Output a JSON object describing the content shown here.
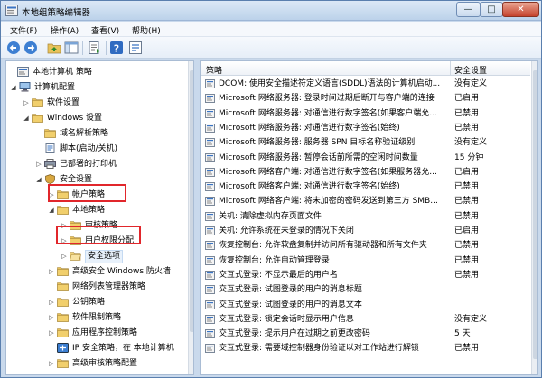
{
  "window": {
    "title": "本地组策略编辑器",
    "minimize_label": "—",
    "maximize_label": "□",
    "close_label": "✕"
  },
  "menu": {
    "items": [
      "文件(F)",
      "操作(A)",
      "查看(V)",
      "帮助(H)"
    ]
  },
  "toolbar": {
    "icons": [
      "back-arrow-icon",
      "forward-arrow-icon",
      "up-folder-icon",
      "show-hide-tree-icon",
      "export-list-icon",
      "help-icon",
      "properties-icon"
    ]
  },
  "tree": {
    "items": [
      {
        "label": "本地计算机 策略",
        "icon": "computer-policy-icon",
        "expander": ""
      },
      {
        "label": "计算机配置",
        "icon": "computer-config-icon",
        "expander": "◢"
      },
      {
        "label": "软件设置",
        "icon": "folder-icon",
        "expander": "▷"
      },
      {
        "label": "Windows 设置",
        "icon": "folder-icon",
        "expander": "◢"
      },
      {
        "label": "域名解析策略",
        "icon": "folder-icon",
        "expander": ""
      },
      {
        "label": "脚本(启动/关机)",
        "icon": "script-icon",
        "expander": ""
      },
      {
        "label": "已部署的打印机",
        "icon": "printer-icon",
        "expander": "▷"
      },
      {
        "label": "安全设置",
        "icon": "security-settings-icon",
        "expander": "◢"
      },
      {
        "label": "帐户策略",
        "icon": "folder-icon",
        "expander": "▷"
      },
      {
        "label": "本地策略",
        "icon": "folder-icon",
        "expander": "◢"
      },
      {
        "label": "审核策略",
        "icon": "folder-icon",
        "expander": "▷"
      },
      {
        "label": "用户权限分配",
        "icon": "folder-icon",
        "expander": "▷"
      },
      {
        "label": "安全选项",
        "icon": "folder-open-icon",
        "expander": "▷"
      },
      {
        "label": "高级安全 Windows 防火墙",
        "icon": "folder-icon",
        "expander": "▷"
      },
      {
        "label": "网络列表管理器策略",
        "icon": "folder-icon",
        "expander": ""
      },
      {
        "label": "公钥策略",
        "icon": "folder-icon",
        "expander": "▷"
      },
      {
        "label": "软件限制策略",
        "icon": "folder-icon",
        "expander": "▷"
      },
      {
        "label": "应用程序控制策略",
        "icon": "folder-icon",
        "expander": "▷"
      },
      {
        "label": "IP 安全策略，在 本地计算机",
        "icon": "ip-security-icon",
        "expander": ""
      },
      {
        "label": "高级审核策略配置",
        "icon": "folder-icon",
        "expander": "▷"
      }
    ]
  },
  "policies": {
    "headers": {
      "policy": "策略",
      "setting": "安全设置"
    },
    "rows": [
      {
        "name": "DCOM: 使用安全描述符定义语言(SDDL)语法的计算机启动...",
        "setting": "没有定义"
      },
      {
        "name": "Microsoft 网络服务器: 登录时间过期后断开与客户端的连接",
        "setting": "已启用"
      },
      {
        "name": "Microsoft 网络服务器: 对通信进行数字签名(如果客户端允...",
        "setting": "已禁用"
      },
      {
        "name": "Microsoft 网络服务器: 对通信进行数字签名(始终)",
        "setting": "已禁用"
      },
      {
        "name": "Microsoft 网络服务器: 服务器 SPN 目标名称验证级别",
        "setting": "没有定义"
      },
      {
        "name": "Microsoft 网络服务器: 暂停会话前所需的空闲时间数量",
        "setting": "15 分钟"
      },
      {
        "name": "Microsoft 网络客户端: 对通信进行数字签名(如果服务器允...",
        "setting": "已启用"
      },
      {
        "name": "Microsoft 网络客户端: 对通信进行数字签名(始终)",
        "setting": "已禁用"
      },
      {
        "name": "Microsoft 网络客户端: 将未加密的密码发送到第三方 SMB...",
        "setting": "已禁用"
      },
      {
        "name": "关机: 清除虚拟内存页面文件",
        "setting": "已禁用"
      },
      {
        "name": "关机: 允许系统在未登录的情况下关闭",
        "setting": "已启用"
      },
      {
        "name": "恢复控制台: 允许软盘复制并访问所有驱动器和所有文件夹",
        "setting": "已禁用"
      },
      {
        "name": "恢复控制台: 允许自动管理登录",
        "setting": "已禁用"
      },
      {
        "name": "交互式登录: 不显示最后的用户名",
        "setting": "已禁用"
      },
      {
        "name": "交互式登录: 试图登录的用户的消息标题",
        "setting": ""
      },
      {
        "name": "交互式登录: 试图登录的用户的消息文本",
        "setting": ""
      },
      {
        "name": "交互式登录: 锁定会话时显示用户信息",
        "setting": "没有定义"
      },
      {
        "name": "交互式登录: 提示用户在过期之前更改密码",
        "setting": "5 天"
      },
      {
        "name": "交互式登录: 需要域控制器身份验证以对工作站进行解锁",
        "setting": "已禁用"
      }
    ]
  },
  "colors": {
    "highlight_box": "#e1262b",
    "folder": "#e8c25a",
    "accent": "#3a74c4"
  }
}
